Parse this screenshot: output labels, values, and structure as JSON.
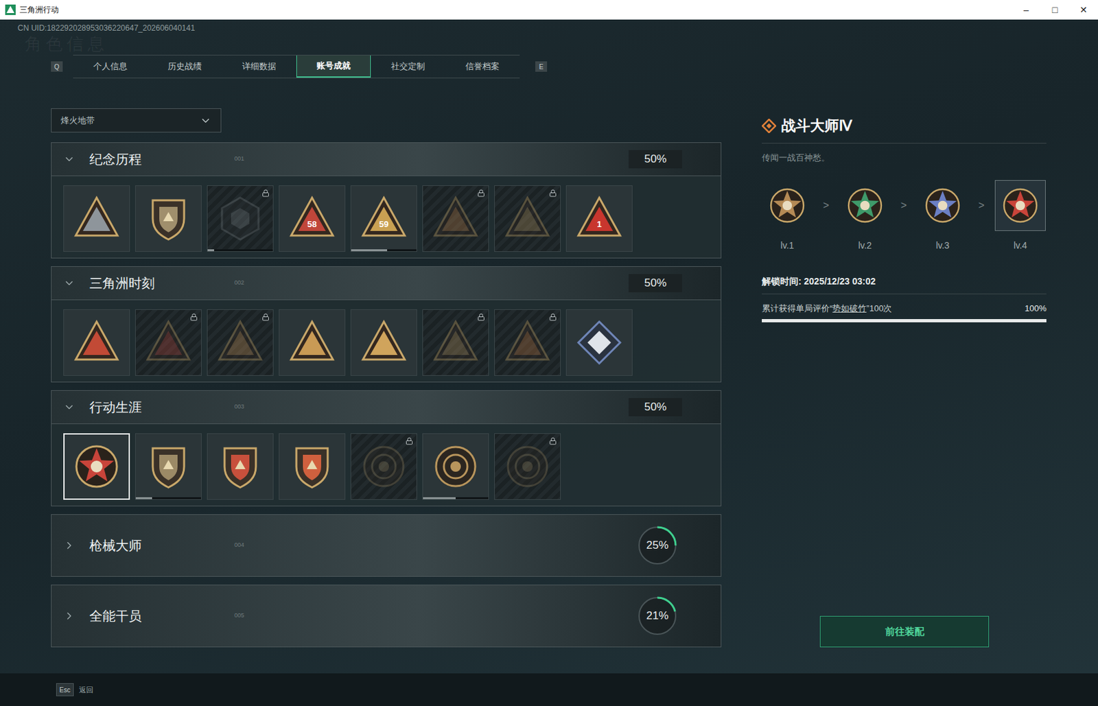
{
  "window": {
    "title": "三角洲行动",
    "controls": [
      "–",
      "□",
      "✕"
    ]
  },
  "uid": "CN UID:182292028953036220647_202606040141",
  "watermark": "角色信息",
  "tabs": {
    "prev_key": "Q",
    "next_key": "E",
    "items": [
      {
        "label": "个人信息",
        "selected": false
      },
      {
        "label": "历史战绩",
        "selected": false
      },
      {
        "label": "详细数据",
        "selected": false
      },
      {
        "label": "账号成就",
        "selected": true
      },
      {
        "label": "社交定制",
        "selected": false
      },
      {
        "label": "信誉档案",
        "selected": false
      }
    ]
  },
  "mode_select": {
    "value": "烽火地带"
  },
  "sections": [
    {
      "title": "纪念历程",
      "code": "001",
      "percent": "50%",
      "expanded": true,
      "badges": [
        {
          "kind": "triangle",
          "color": "#8e959b",
          "locked": false,
          "selected": false
        },
        {
          "kind": "shield",
          "color": "#a08f6c",
          "locked": false,
          "selected": false
        },
        {
          "kind": "hex",
          "color": "#6c7478",
          "locked": true,
          "selected": false,
          "level": 0.1
        },
        {
          "kind": "triangle",
          "color": "#c0463a",
          "locked": false,
          "selected": false,
          "label": "58"
        },
        {
          "kind": "triangle",
          "color": "#c9a052",
          "locked": false,
          "selected": false,
          "label": "59",
          "level": 0.55
        },
        {
          "kind": "triangle",
          "color": "#b07a48",
          "locked": true,
          "selected": false
        },
        {
          "kind": "triangle",
          "color": "#a58a5a",
          "locked": true,
          "selected": false
        },
        {
          "kind": "triangle",
          "color": "#c8362e",
          "locked": false,
          "selected": false,
          "label": "1"
        }
      ]
    },
    {
      "title": "三角洲时刻",
      "code": "002",
      "percent": "50%",
      "expanded": true,
      "badges": [
        {
          "kind": "triangle",
          "color": "#c24a36",
          "locked": false,
          "selected": false
        },
        {
          "kind": "triangle",
          "color": "#a8423a",
          "locked": true,
          "selected": false
        },
        {
          "kind": "triangle",
          "color": "#b98a52",
          "locked": true,
          "selected": false
        },
        {
          "kind": "triangle",
          "color": "#c99a55",
          "locked": false,
          "selected": false
        },
        {
          "kind": "triangle",
          "color": "#d0a45c",
          "locked": false,
          "selected": false
        },
        {
          "kind": "triangle",
          "color": "#a88a5a",
          "locked": true,
          "selected": false
        },
        {
          "kind": "triangle",
          "color": "#b07040",
          "locked": true,
          "selected": false
        },
        {
          "kind": "diamond",
          "color": "#6f86b8",
          "locked": false,
          "selected": false
        }
      ]
    },
    {
      "title": "行动生涯",
      "code": "003",
      "percent": "50%",
      "expanded": true,
      "badges": [
        {
          "kind": "star",
          "color": "#c9443a",
          "locked": false,
          "selected": true
        },
        {
          "kind": "shield",
          "color": "#9c8a66",
          "locked": false,
          "selected": false,
          "level": 0.25
        },
        {
          "kind": "shield",
          "color": "#c8503c",
          "locked": false,
          "selected": false
        },
        {
          "kind": "shield",
          "color": "#d0603e",
          "locked": false,
          "selected": false
        },
        {
          "kind": "circle",
          "color": "#8a7a5a",
          "locked": true,
          "selected": false
        },
        {
          "kind": "circle",
          "color": "#b8955c",
          "locked": false,
          "selected": false,
          "level": 0.5
        },
        {
          "kind": "circle",
          "color": "#8a7a5a",
          "locked": true,
          "selected": false
        }
      ]
    },
    {
      "title": "枪械大师",
      "code": "004",
      "percent": "25%",
      "expanded": false,
      "level": 0.25,
      "badges": []
    },
    {
      "title": "全能干员",
      "code": "005",
      "percent": "21%",
      "expanded": false,
      "level": 0.21,
      "badges": []
    }
  ],
  "detail": {
    "title": "战斗大师Ⅳ",
    "description": "传闻一战百神愁。",
    "arrow": ">",
    "levels": [
      {
        "label": "lv.1",
        "color": "#b58a55",
        "selected": false
      },
      {
        "label": "lv.2",
        "color": "#3f9a6a",
        "selected": false
      },
      {
        "label": "lv.3",
        "color": "#6b7fc4",
        "selected": false
      },
      {
        "label": "lv.4",
        "color": "#c9443a",
        "selected": true
      }
    ],
    "unlock_time": "解锁时间: 2025/12/23 03:02",
    "requirement": {
      "prefix": "累计获得单局评价“",
      "highlight": "势如破竹",
      "suffix": "”100次",
      "reading": "100%",
      "level": 1
    },
    "button": "前往装配"
  },
  "footer": {
    "key": "Esc",
    "label": "返回"
  }
}
